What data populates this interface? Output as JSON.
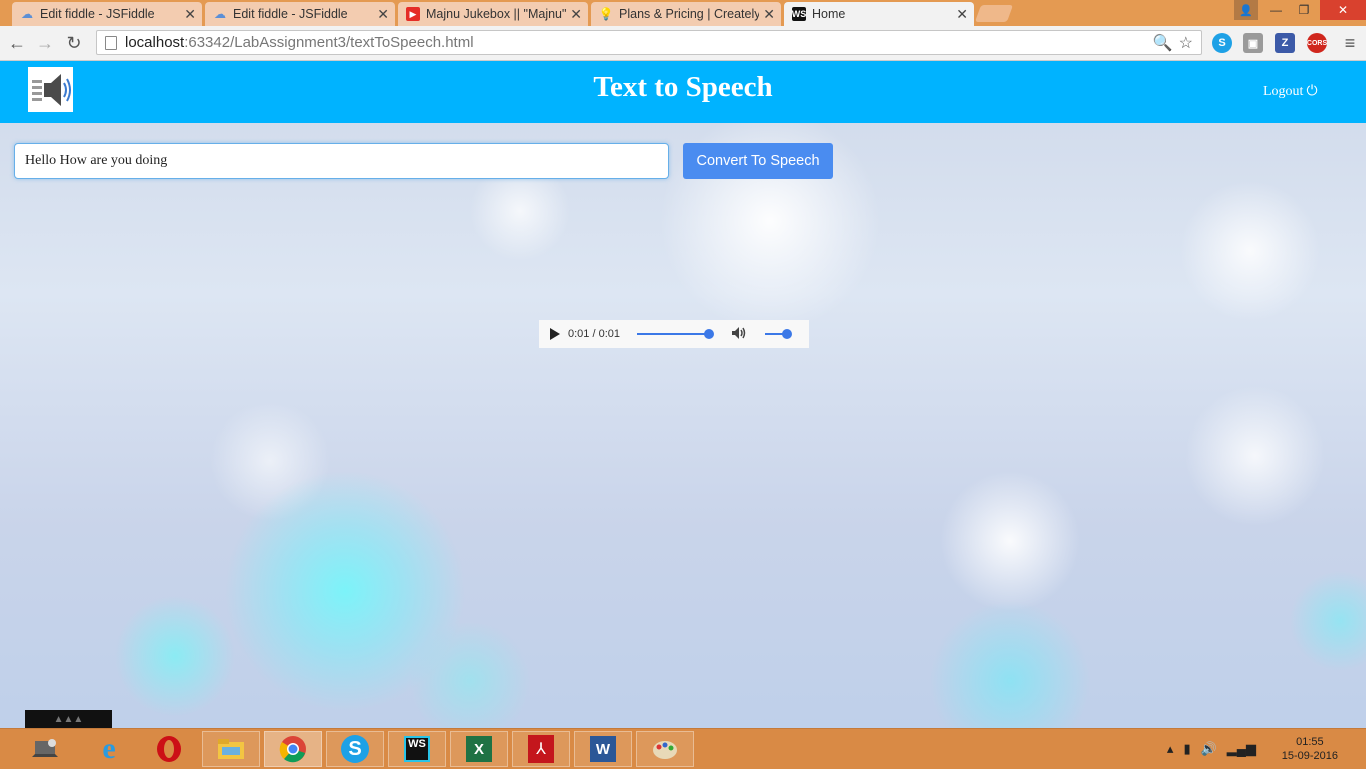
{
  "browser": {
    "tabs": [
      {
        "label": "Edit fiddle - JSFiddle",
        "icon": "jsfiddle-icon"
      },
      {
        "label": "Edit fiddle - JSFiddle",
        "icon": "jsfiddle-icon"
      },
      {
        "label": "Majnu Jukebox || \"Majnu\"",
        "icon": "youtube-icon"
      },
      {
        "label": "Plans & Pricing | Creately",
        "icon": "creately-icon"
      },
      {
        "label": "Home",
        "icon": "webstorm-icon"
      }
    ],
    "address": {
      "host": "localhost",
      "path": ":63342/LabAssignment3/textToSpeech.html"
    },
    "extensions": [
      "skype-icon",
      "extension-icon",
      "zotero-icon",
      "cors-icon"
    ],
    "cors_label": "CORS",
    "zotero_label": "Z"
  },
  "app": {
    "title": "Text to Speech",
    "logout_label": "Logout",
    "input_value": "Hello How are you doing",
    "convert_label": "Convert To Speech",
    "audio": {
      "time": "0:01 / 0:01",
      "progress": 1.0,
      "volume": 1.0
    }
  },
  "taskbar": {
    "items": [
      "laptop-icon",
      "internet-explorer-icon",
      "opera-icon",
      "file-explorer-icon",
      "chrome-icon",
      "skype-icon",
      "webstorm-icon",
      "excel-icon",
      "acrobat-icon",
      "word-icon",
      "paint-icon"
    ],
    "time": "01:55",
    "date": "15-09-2016"
  }
}
